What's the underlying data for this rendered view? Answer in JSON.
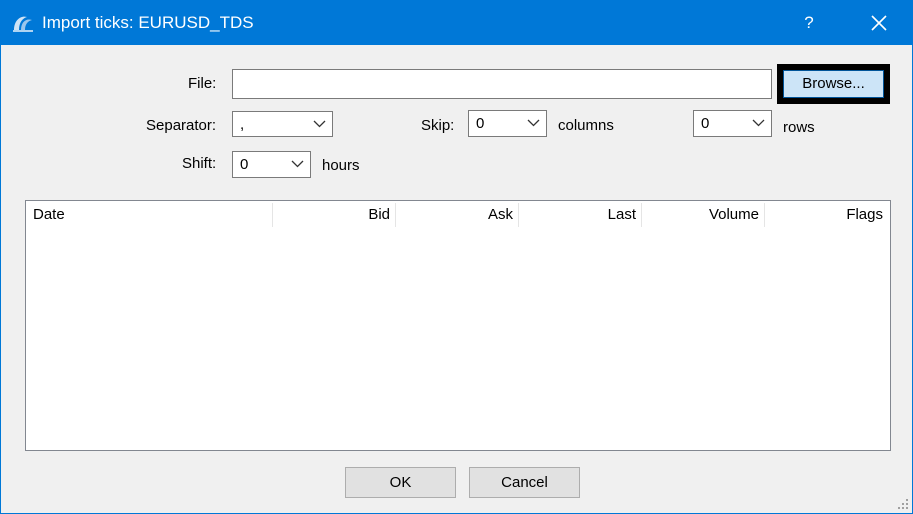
{
  "window": {
    "title": "Import ticks: EURUSD_TDS",
    "help_glyph": "?",
    "accent_color": "#0078d7"
  },
  "form": {
    "file_label": "File:",
    "file_value": "",
    "browse_label": "Browse...",
    "separator_label": "Separator:",
    "separator_value": ",",
    "skip_label": "Skip:",
    "skip_columns_value": "0",
    "columns_label": "columns",
    "skip_rows_value": "0",
    "rows_label": "rows",
    "shift_label": "Shift:",
    "shift_value": "0",
    "hours_label": "hours"
  },
  "table": {
    "columns": [
      "Date",
      "Bid",
      "Ask",
      "Last",
      "Volume",
      "Flags"
    ],
    "rows": []
  },
  "footer": {
    "ok_label": "OK",
    "cancel_label": "Cancel"
  },
  "icons": {
    "app": "metatrader-logo-icon",
    "close": "close-icon",
    "help": "help-icon",
    "dropdown": "chevron-down-icon",
    "resize": "resize-grip-icon"
  }
}
